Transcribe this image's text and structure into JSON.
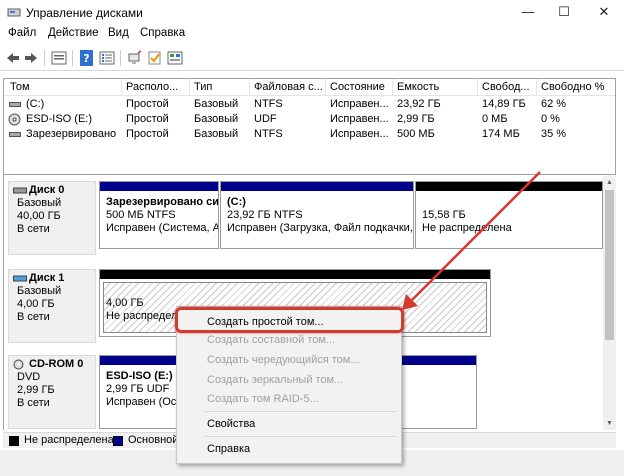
{
  "window": {
    "title": "Управление дисками",
    "min": "—",
    "max": "☐",
    "close": "✕"
  },
  "menu": [
    "Файл",
    "Действие",
    "Вид",
    "Справка"
  ],
  "toolbar_icons": [
    "back-arrow-icon",
    "forward-arrow-icon",
    "properties-icon",
    "help-icon",
    "list-view-icon",
    "connect-icon",
    "check-icon",
    "refresh-icon"
  ],
  "volumes": {
    "headers": [
      "Том",
      "Располо...",
      "Тип",
      "Файловая с...",
      "Состояние",
      "Емкость",
      "Свобод...",
      "Свободно %"
    ],
    "rows": [
      [
        "(C:)",
        "Простой",
        "Базовый",
        "NTFS",
        "Исправен...",
        "23,92 ГБ",
        "14,89 ГБ",
        "62 %"
      ],
      [
        "ESD-ISO (E:)",
        "Простой",
        "Базовый",
        "UDF",
        "Исправен...",
        "2,99 ГБ",
        "0 МБ",
        "0 %"
      ],
      [
        "Зарезервировано ...",
        "Простой",
        "Базовый",
        "NTFS",
        "Исправен...",
        "500 МБ",
        "174 МБ",
        "35 %"
      ]
    ]
  },
  "disks": [
    {
      "name": "Диск 0",
      "type": "Базовый",
      "size": "40,00 ГБ",
      "status": "В сети",
      "partitions": [
        {
          "title": "Зарезервировано си",
          "line1": "500 МБ NTFS",
          "line2": "Исправен (Система, А"
        },
        {
          "title": "(C:)",
          "line1": "23,92 ГБ NTFS",
          "line2": "Исправен (Загрузка, Файл подкачки,"
        },
        {
          "title": "",
          "line1": "15,58 ГБ",
          "line2": "Не распределена"
        }
      ]
    },
    {
      "name": "Диск 1",
      "type": "Базовый",
      "size": "4,00 ГБ",
      "status": "В сети",
      "partitions": [
        {
          "title": "",
          "line1": "4,00 ГБ",
          "line2": "Не распредел"
        }
      ]
    },
    {
      "name": "CD-ROM 0",
      "type": "DVD",
      "size": "2,99 ГБ",
      "status": "В сети",
      "partitions": [
        {
          "title": "ESD-ISO  (E:)",
          "line1": "2,99 ГБ UDF",
          "line2": "Исправен (Осн"
        }
      ]
    }
  ],
  "legend": [
    {
      "label": "Не распределена",
      "color": "#000000"
    },
    {
      "label": "Основной",
      "color": "#00008b"
    }
  ],
  "context_menu": {
    "items": [
      {
        "label": "Создать простой том...",
        "enabled": true
      },
      {
        "label": "Создать составной том...",
        "enabled": false
      },
      {
        "label": "Создать чередующийся том...",
        "enabled": false
      },
      {
        "label": "Создать зеркальный том...",
        "enabled": false
      },
      {
        "label": "Создать том RAID-5...",
        "enabled": false
      },
      {
        "label": "Свойства",
        "enabled": true
      },
      {
        "label": "Справка",
        "enabled": true
      }
    ]
  },
  "colors": {
    "primary_stripe": "#00008b",
    "unallocated_stripe": "#000000",
    "highlight": "#d23a2d"
  }
}
